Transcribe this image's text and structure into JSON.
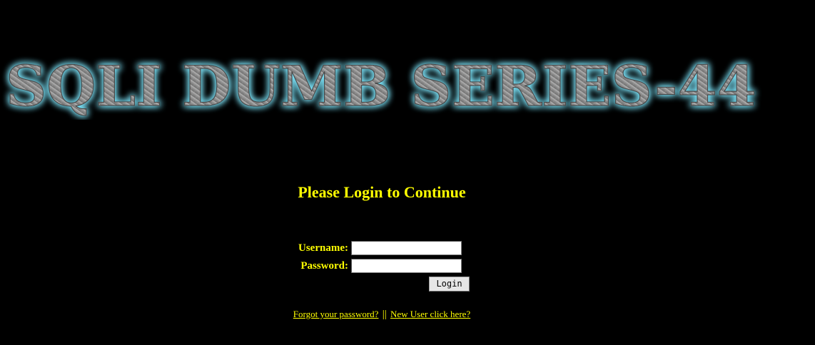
{
  "banner": {
    "title": "SQLI DUMB SERIES-44"
  },
  "login": {
    "heading": "Please Login to Continue",
    "username_label": "Username:",
    "username_value": "",
    "password_label": "Password:",
    "password_value": "",
    "submit_label": "Login"
  },
  "links": {
    "forgot_password": "Forgot your password?",
    "separator": "||",
    "new_user": "New User click here?"
  },
  "colors": {
    "background": "#000000",
    "accent_text": "#ffff00",
    "banner_fill": "#8e8e8e",
    "banner_glow": "#7fe9ff"
  }
}
